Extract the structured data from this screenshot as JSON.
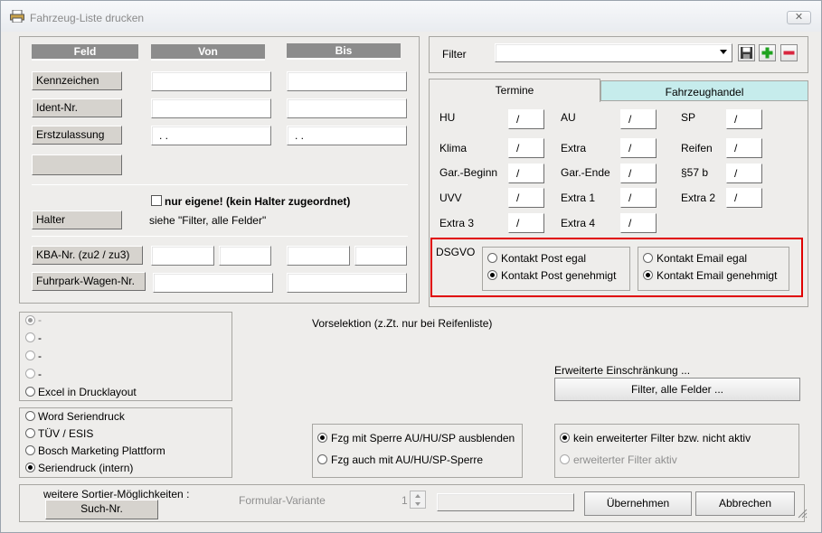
{
  "window": {
    "title": "Fahrzeug-Liste drucken",
    "close_label": "✕"
  },
  "fields": {
    "col_feld": "Feld",
    "col_von": "Von",
    "col_bis": "Bis",
    "kennzeichen": "Kennzeichen",
    "ident_nr": "Ident-Nr.",
    "erstzulassung": "Erstzulassung",
    "date_placeholder_von": ". .",
    "date_placeholder_bis": ". .",
    "nur_eigene": "nur eigene! (kein Halter zugeordnet)",
    "halter": "Halter",
    "siehe_filter": "siehe \"Filter, alle Felder\"",
    "kba_nr": "KBA-Nr. (zu2 / zu3)",
    "fuhrpark": "Fuhrpark-Wagen-Nr."
  },
  "filter": {
    "label": "Filter",
    "value": ""
  },
  "tabs": {
    "termine": "Termine",
    "fahrzeughandel": "Fahrzeughandel"
  },
  "termine": {
    "rows": [
      [
        {
          "label": "HU",
          "value": "/"
        },
        {
          "label": "AU",
          "value": "/"
        },
        {
          "label": "SP",
          "value": "/"
        }
      ],
      [
        {
          "label": "Klima",
          "value": "/"
        },
        {
          "label": "Extra",
          "value": "/"
        },
        {
          "label": "Reifen",
          "value": "/"
        }
      ],
      [
        {
          "label": "Gar.-Beginn",
          "value": "/"
        },
        {
          "label": "Gar.-Ende",
          "value": "/"
        },
        {
          "label": "§57 b",
          "value": "/"
        }
      ],
      [
        {
          "label": "UVV",
          "value": "/"
        },
        {
          "label": "Extra 1",
          "value": "/"
        },
        {
          "label": "Extra 2",
          "value": "/"
        }
      ],
      [
        {
          "label": "Extra 3",
          "value": "/"
        },
        {
          "label": "Extra 4",
          "value": "/"
        }
      ]
    ]
  },
  "dsgvo": {
    "label": "DSGVO",
    "post_egal": "Kontakt Post egal",
    "post_genehmigt": "Kontakt Post genehmigt",
    "email_egal": "Kontakt Email egal",
    "email_genehmigt": "Kontakt Email genehmigt",
    "highlight_color": "#e00000"
  },
  "layout_options": [
    "-",
    "-",
    "-",
    "-",
    "Excel in Drucklayout"
  ],
  "serien_options": [
    "Word Seriendruck",
    "TÜV / ESIS",
    "Bosch Marketing Plattform",
    "Seriendruck (intern)"
  ],
  "vorselektion": "Vorselektion (z.Zt. nur bei Reifenliste)",
  "erweiterte": {
    "label": "Erweiterte Einschränkung ...",
    "button": "Filter, alle Felder ..."
  },
  "sperre": {
    "ausblenden": "Fzg mit Sperre AU/HU/SP ausblenden",
    "auch": "Fzg auch mit AU/HU/SP-Sperre"
  },
  "filter_status": {
    "kein": "kein erweiterter Filter bzw. nicht aktiv",
    "aktiv": "erweiterter Filter aktiv"
  },
  "bottom": {
    "sortier_label": "weitere Sortier-Möglichkeiten :",
    "such_nr": "Such-Nr.",
    "formular_variante": "Formular-Variante",
    "variante_value": "1",
    "uebernehmen": "Übernehmen",
    "abbrechen": "Abbrechen"
  }
}
